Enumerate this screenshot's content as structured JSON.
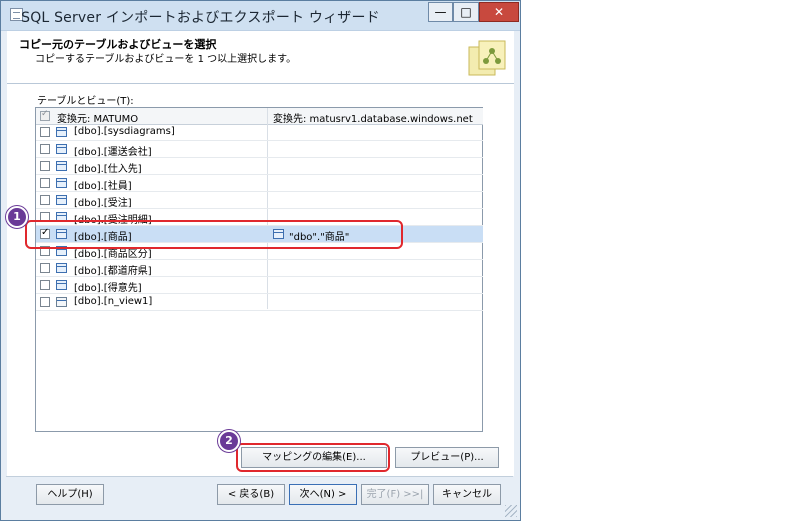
{
  "window": {
    "title": "SQL Server インポートおよびエクスポート ウィザード",
    "minimize_glyph": "—",
    "maximize_glyph": "□",
    "close_glyph": "✕"
  },
  "header": {
    "title": "コピー元のテーブルおよびビューを選択",
    "subtitle": "コピーするテーブルおよびビューを 1 つ以上選択します。"
  },
  "list": {
    "label": "テーブルとビュー(T):",
    "col_source": "変換元: MATUMO",
    "col_dest": "変換先: matusrv1.database.windows.net",
    "rows": [
      {
        "name": "[dbo].[sysdiagrams]",
        "checked": false,
        "dest": "",
        "type": "table"
      },
      {
        "name": "[dbo].[運送会社]",
        "checked": false,
        "dest": "",
        "type": "table"
      },
      {
        "name": "[dbo].[仕入先]",
        "checked": false,
        "dest": "",
        "type": "table"
      },
      {
        "name": "[dbo].[社員]",
        "checked": false,
        "dest": "",
        "type": "table"
      },
      {
        "name": "[dbo].[受注]",
        "checked": false,
        "dest": "",
        "type": "table"
      },
      {
        "name": "[dbo].[受注明細]",
        "checked": false,
        "dest": "",
        "type": "table"
      },
      {
        "name": "[dbo].[商品]",
        "checked": true,
        "dest": "\"dbo\".\"商品\"",
        "type": "table"
      },
      {
        "name": "[dbo].[商品区分]",
        "checked": false,
        "dest": "",
        "type": "table"
      },
      {
        "name": "[dbo].[都道府県]",
        "checked": false,
        "dest": "",
        "type": "table"
      },
      {
        "name": "[dbo].[得意先]",
        "checked": false,
        "dest": "",
        "type": "table"
      },
      {
        "name": "[dbo].[n_view1]",
        "checked": false,
        "dest": "",
        "type": "view"
      }
    ]
  },
  "buttons": {
    "edit_mappings": "マッピングの編集(E)...",
    "preview": "プレビュー(P)...",
    "help": "ヘルプ(H)",
    "back": "< 戻る(B)",
    "next": "次へ(N) >",
    "finish": "完了(F) >>|",
    "cancel": "キャンセル"
  },
  "annotations": {
    "badge1": "1",
    "badge2": "2",
    "callout_color": "#e0282d",
    "badge_color": "#6a3a97"
  }
}
